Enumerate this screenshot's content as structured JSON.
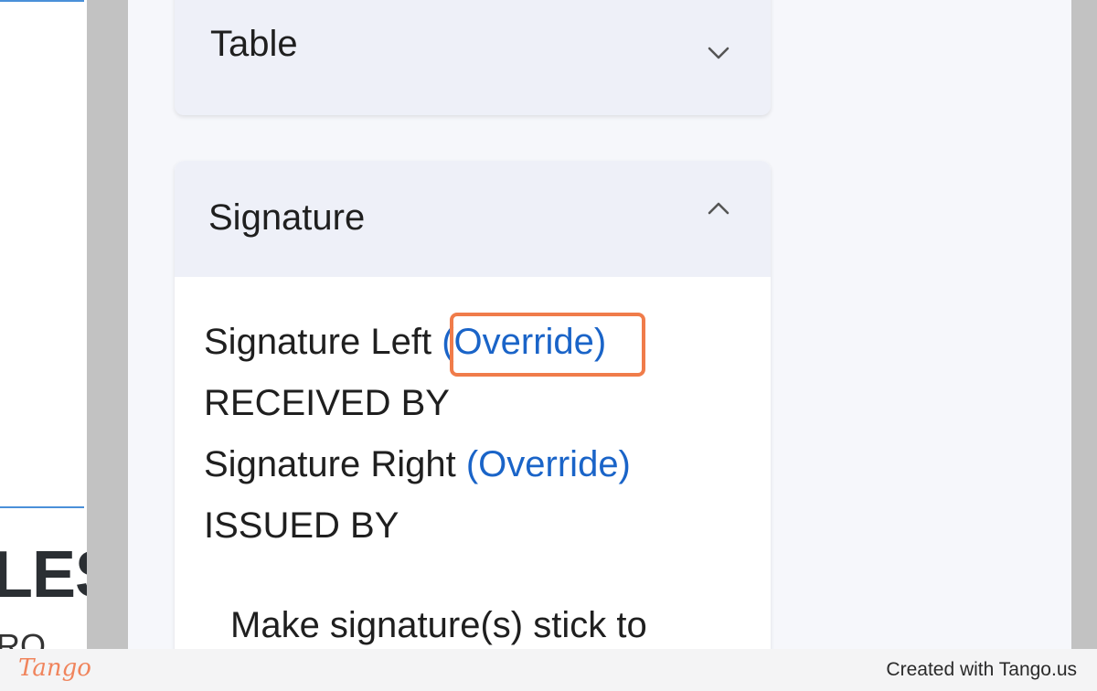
{
  "document": {
    "heading_fragment": "LES",
    "sub_fragment": "RO"
  },
  "panel": {
    "table_section": {
      "title": "Table",
      "expanded": false,
      "toggle_icon": "chevron-down-icon"
    },
    "signature_section": {
      "title": "Signature",
      "expanded": true,
      "toggle_icon": "chevron-up-icon",
      "signature_left_label": "Signature Left",
      "signature_left_override": "(Override)",
      "signature_left_value": "RECEIVED BY",
      "signature_right_label": "Signature Right",
      "signature_right_override": "(Override)",
      "signature_right_value": "ISSUED BY",
      "stick_option_label": "Make signature(s) stick to"
    }
  },
  "footer": {
    "brand": "Tango",
    "created_with": "Created with Tango.us"
  },
  "colors": {
    "link": "#1a64c8",
    "highlight": "#f07c4a",
    "brand": "#f0845c",
    "card_header": "#eef0f8"
  }
}
